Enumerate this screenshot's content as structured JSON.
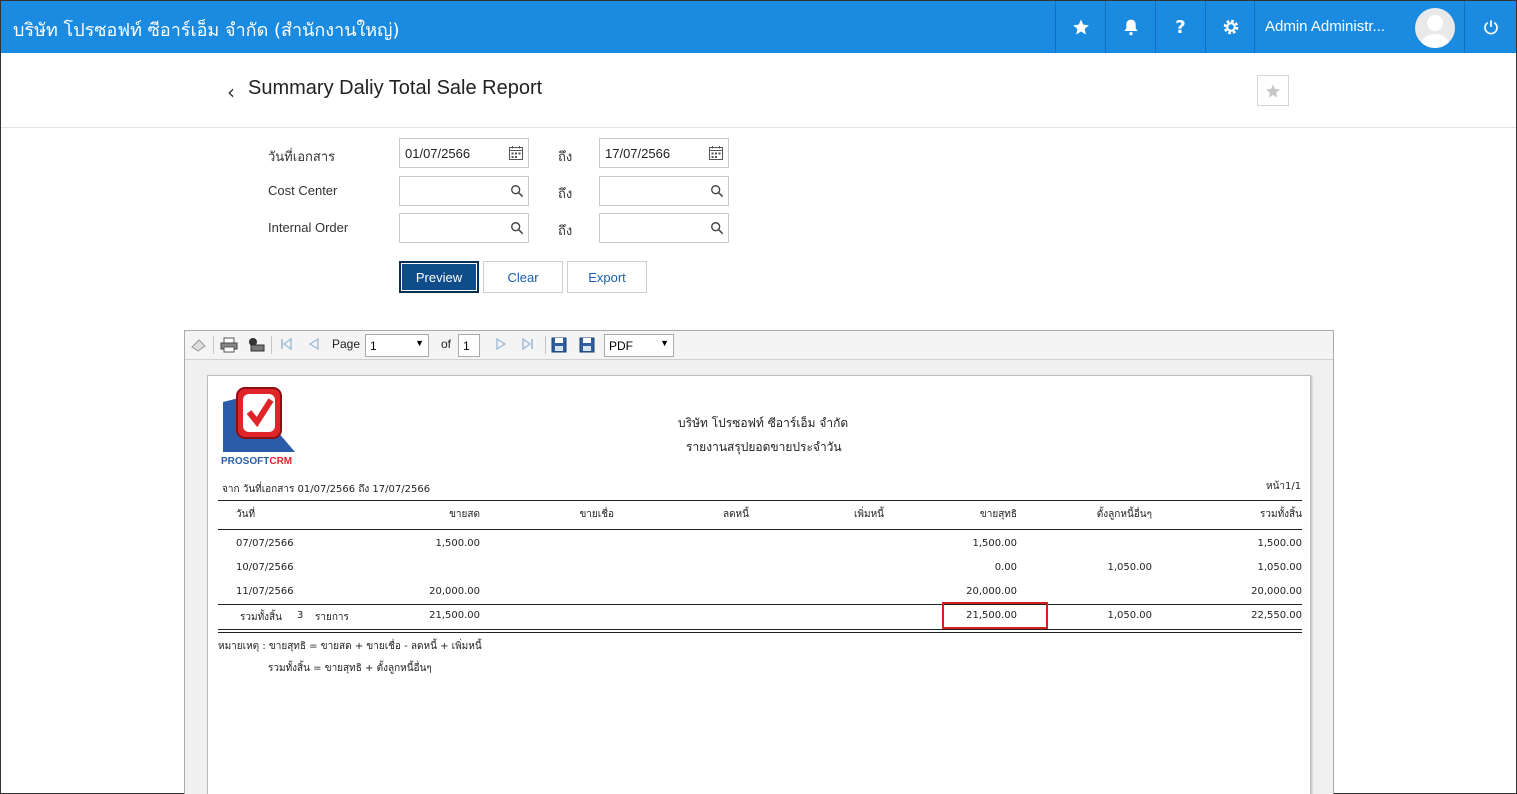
{
  "header": {
    "company": "บริษัท โปรซอฟท์ ซีอาร์เอ็ม จำกัด (สำนักงานใหญ่)",
    "user_name": "Admin Administr...",
    "accent": "#1a8be0"
  },
  "page": {
    "title": "Summary Daliy Total Sale Report",
    "back_icon": "chevron-left-icon",
    "favorite_icon": "star-icon"
  },
  "form": {
    "doc_date_label": "วันที่เอกสาร",
    "cost_center_label": "Cost Center",
    "internal_order_label": "Internal Order",
    "to_label": "ถึง",
    "date_from": "01/07/2566",
    "date_to": "17/07/2566",
    "cost_center_from": "",
    "cost_center_to": "",
    "internal_order_from": "",
    "internal_order_to": ""
  },
  "buttons": {
    "preview": "Preview",
    "clear": "Clear",
    "export": "Export"
  },
  "viewer": {
    "page_label": "Page",
    "page_value": "1",
    "of_label": "of",
    "total_pages": "1",
    "format": "PDF"
  },
  "report": {
    "logo_text_1": "PROSOFT",
    "logo_text_2": "CRM",
    "company": "บริษัท โปรซอฟท์ ซีอาร์เอ็ม จำกัด",
    "title": "รายงานสรุปยอดขายประจำวัน",
    "range": "จาก วันที่เอกสาร 01/07/2566 ถึง 17/07/2566",
    "page_no": "หน้า1/1",
    "columns": [
      "วันที่",
      "ขายสด",
      "ขายเชื่อ",
      "ลดหนี้",
      "เพิ่มหนี้",
      "ขายสุทธิ",
      "ตั้งลูกหนี้อื่นๆ",
      "รวมทั้งสิ้น"
    ],
    "rows": [
      [
        "07/07/2566",
        "1,500.00",
        "",
        "",
        "",
        "1,500.00",
        "",
        "1,500.00"
      ],
      [
        "10/07/2566",
        "",
        "",
        "",
        "",
        "0.00",
        "1,050.00",
        "1,050.00"
      ],
      [
        "11/07/2566",
        "20,000.00",
        "",
        "",
        "",
        "20,000.00",
        "",
        "20,000.00"
      ]
    ],
    "total_label": "รวมทั้งสิ้น",
    "total_count": "3",
    "total_unit": "รายการ",
    "totals": [
      "21,500.00",
      "",
      "",
      "",
      "21,500.00",
      "1,050.00",
      "22,550.00"
    ],
    "note_1": "หมายเหตุ : ขายสุทธิ = ขายสด + ขายเชื่อ - ลดหนี้ + เพิ่มหนี้",
    "note_2": "รวมทั้งสิ้น = ขายสุทธิ + ตั้งลูกหนี้อื่นๆ"
  }
}
